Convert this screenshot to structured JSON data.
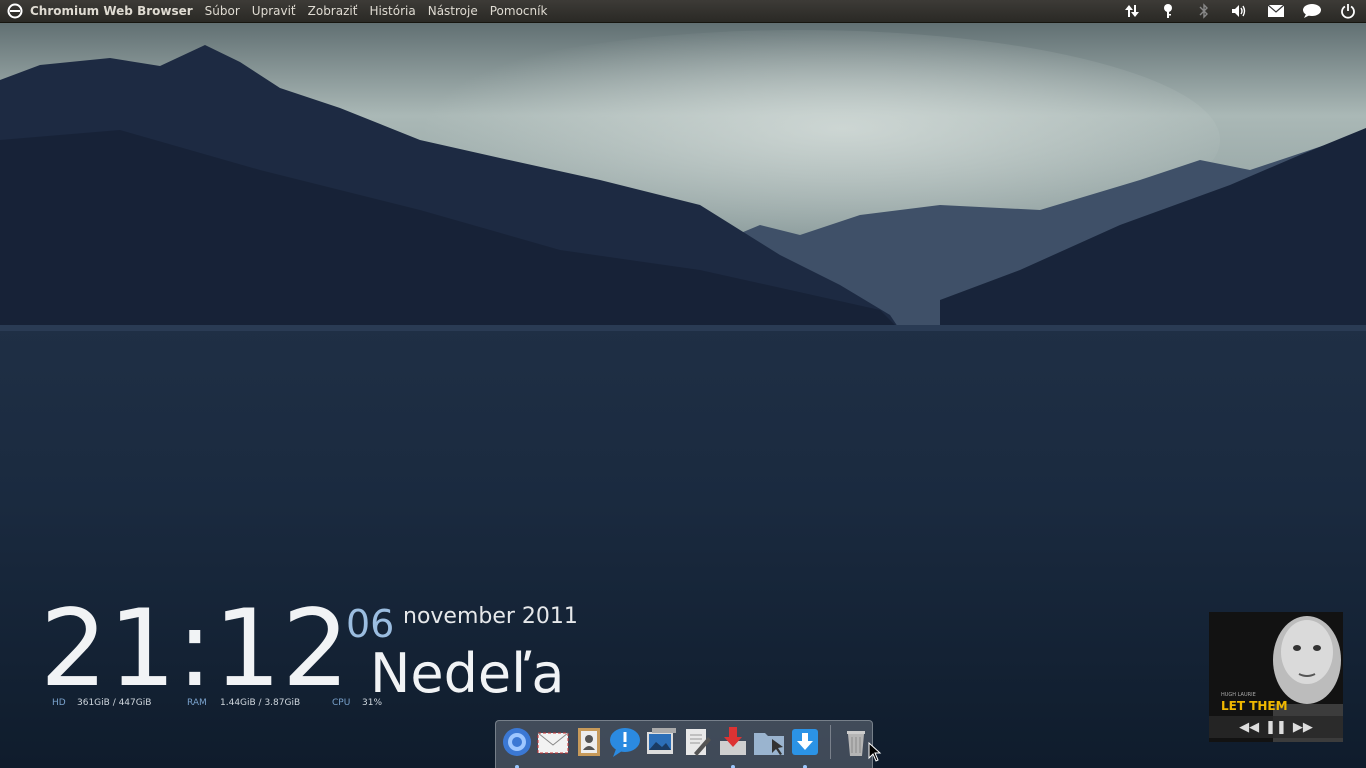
{
  "topbar": {
    "app_name": "Chromium Web Browser",
    "menu": [
      "Súbor",
      "Upraviť",
      "Zobraziť",
      "História",
      "Nástroje",
      "Pomocník"
    ],
    "tray_icons": [
      "network-icon",
      "key-icon",
      "bluetooth-icon",
      "volume-icon",
      "mail-icon",
      "chat-icon",
      "power-icon"
    ]
  },
  "clock": {
    "time": "21:12",
    "day": "06",
    "month_year": "november 2011",
    "weekday": "Nedeľa"
  },
  "stats": {
    "hd_label": "HD",
    "hd_value": "361GiB / 447GiB",
    "ram_label": "RAM",
    "ram_value": "1.44GiB / 3.87GiB",
    "cpu_label": "CPU",
    "cpu_value": "31%"
  },
  "album": {
    "artist": "HUGH LAURIE",
    "title": "LET THEM"
  },
  "dock": {
    "items": [
      "chromium-icon",
      "mail-icon",
      "contacts-icon",
      "chat-icon",
      "image-viewer-icon",
      "text-editor-icon",
      "installer-icon",
      "file-manager-icon",
      "downloads-icon",
      "trash-icon"
    ]
  }
}
